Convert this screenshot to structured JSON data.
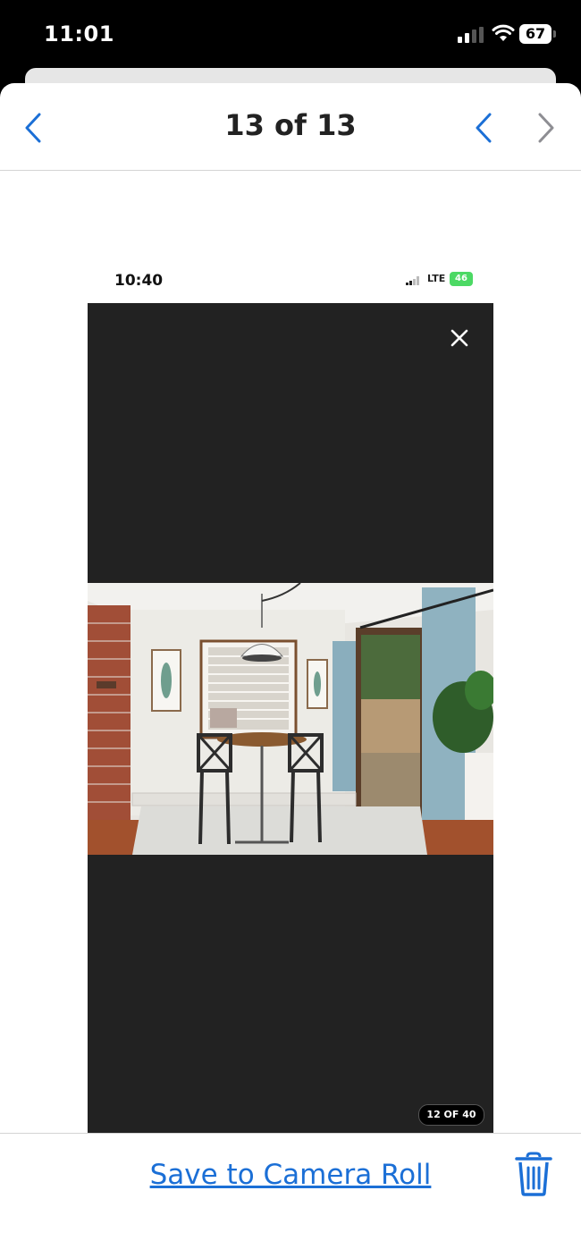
{
  "status_bar": {
    "time": "11:01",
    "battery": "67"
  },
  "nav": {
    "title": "13 of 13"
  },
  "inner_screenshot": {
    "time": "10:40",
    "network": "LTE",
    "battery": "46",
    "counter": "12 OF 40"
  },
  "bottom": {
    "save_label": "Save to Camera Roll"
  },
  "colors": {
    "accent": "#1b6fd6",
    "viewer_bg": "#222222"
  },
  "icons": [
    "chevron-left-icon",
    "chevron-right-icon",
    "close-icon",
    "trash-icon",
    "wifi-icon",
    "signal-icon",
    "battery-icon"
  ]
}
